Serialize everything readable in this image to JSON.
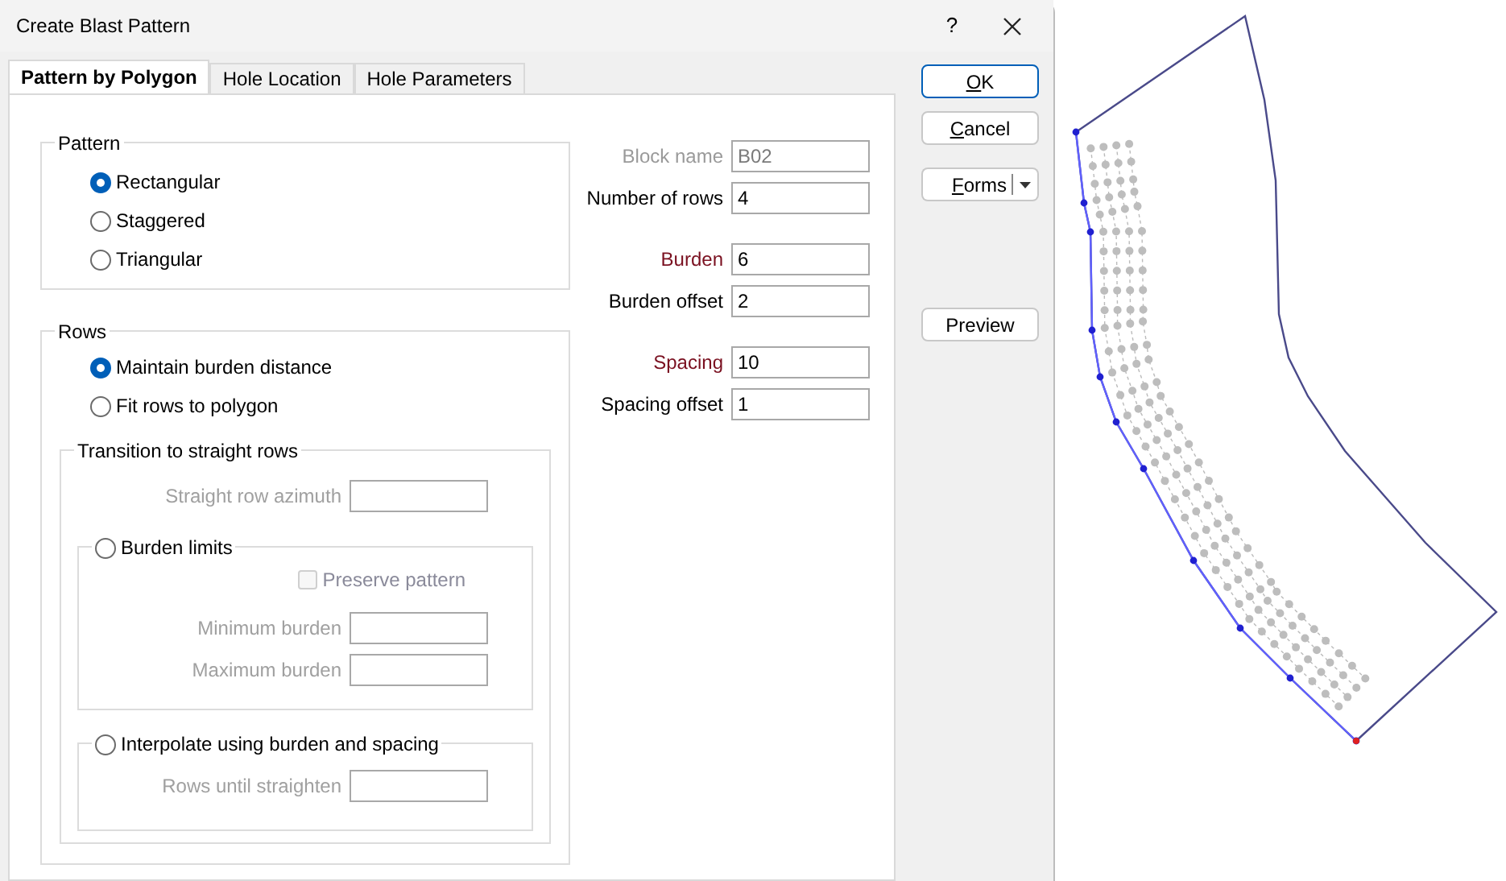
{
  "window": {
    "title": "Create Blast Pattern",
    "help_label": "?"
  },
  "tabs": [
    {
      "label": "Pattern by Polygon",
      "selected": true
    },
    {
      "label": "Hole Location",
      "selected": false
    },
    {
      "label": "Hole Parameters",
      "selected": false
    }
  ],
  "pattern": {
    "title": "Pattern",
    "options": [
      {
        "label": "Rectangular",
        "selected": true
      },
      {
        "label": "Staggered",
        "selected": false
      },
      {
        "label": "Triangular",
        "selected": false
      }
    ]
  },
  "rows": {
    "title": "Rows",
    "options": [
      {
        "label": "Maintain burden distance",
        "selected": true
      },
      {
        "label": "Fit rows to polygon",
        "selected": false
      }
    ],
    "transition": {
      "title": "Transition to straight rows",
      "azimuth": {
        "label": "Straight row azimuth",
        "disabled": true
      },
      "burden_limits": {
        "label": "Burden limits",
        "selected": false,
        "preserve": {
          "label": "Preserve pattern",
          "checked": false,
          "disabled": true
        },
        "fields": [
          {
            "label": "Minimum burden",
            "disabled": true
          },
          {
            "label": "Maximum burden",
            "disabled": true
          }
        ]
      },
      "interpolate": {
        "label": "Interpolate using burden and spacing",
        "selected": false,
        "rows_field": {
          "label": "Rows until straighten",
          "disabled": true
        }
      }
    }
  },
  "field_groups": [
    {
      "fields": [
        {
          "label": "Block name",
          "value": "B02",
          "disabled": true,
          "required": false
        },
        {
          "label": "Number of rows",
          "value": "4",
          "disabled": false,
          "required": false
        }
      ]
    },
    {
      "fields": [
        {
          "label": "Burden",
          "value": "6",
          "disabled": false,
          "required": true
        },
        {
          "label": "Burden offset",
          "value": "2",
          "disabled": false,
          "required": false
        }
      ]
    },
    {
      "fields": [
        {
          "label": "Spacing",
          "value": "10",
          "disabled": false,
          "required": true
        },
        {
          "label": "Spacing offset",
          "value": "1",
          "disabled": false,
          "required": false
        }
      ]
    }
  ],
  "buttons": [
    {
      "kind": "default",
      "key": "O",
      "post": "K"
    },
    {
      "kind": "plain",
      "key": "C",
      "post": "ancel"
    },
    {
      "kind": "split",
      "key": "F",
      "post": "orms"
    },
    {
      "kind": "preview",
      "pre": "Preview"
    }
  ]
}
